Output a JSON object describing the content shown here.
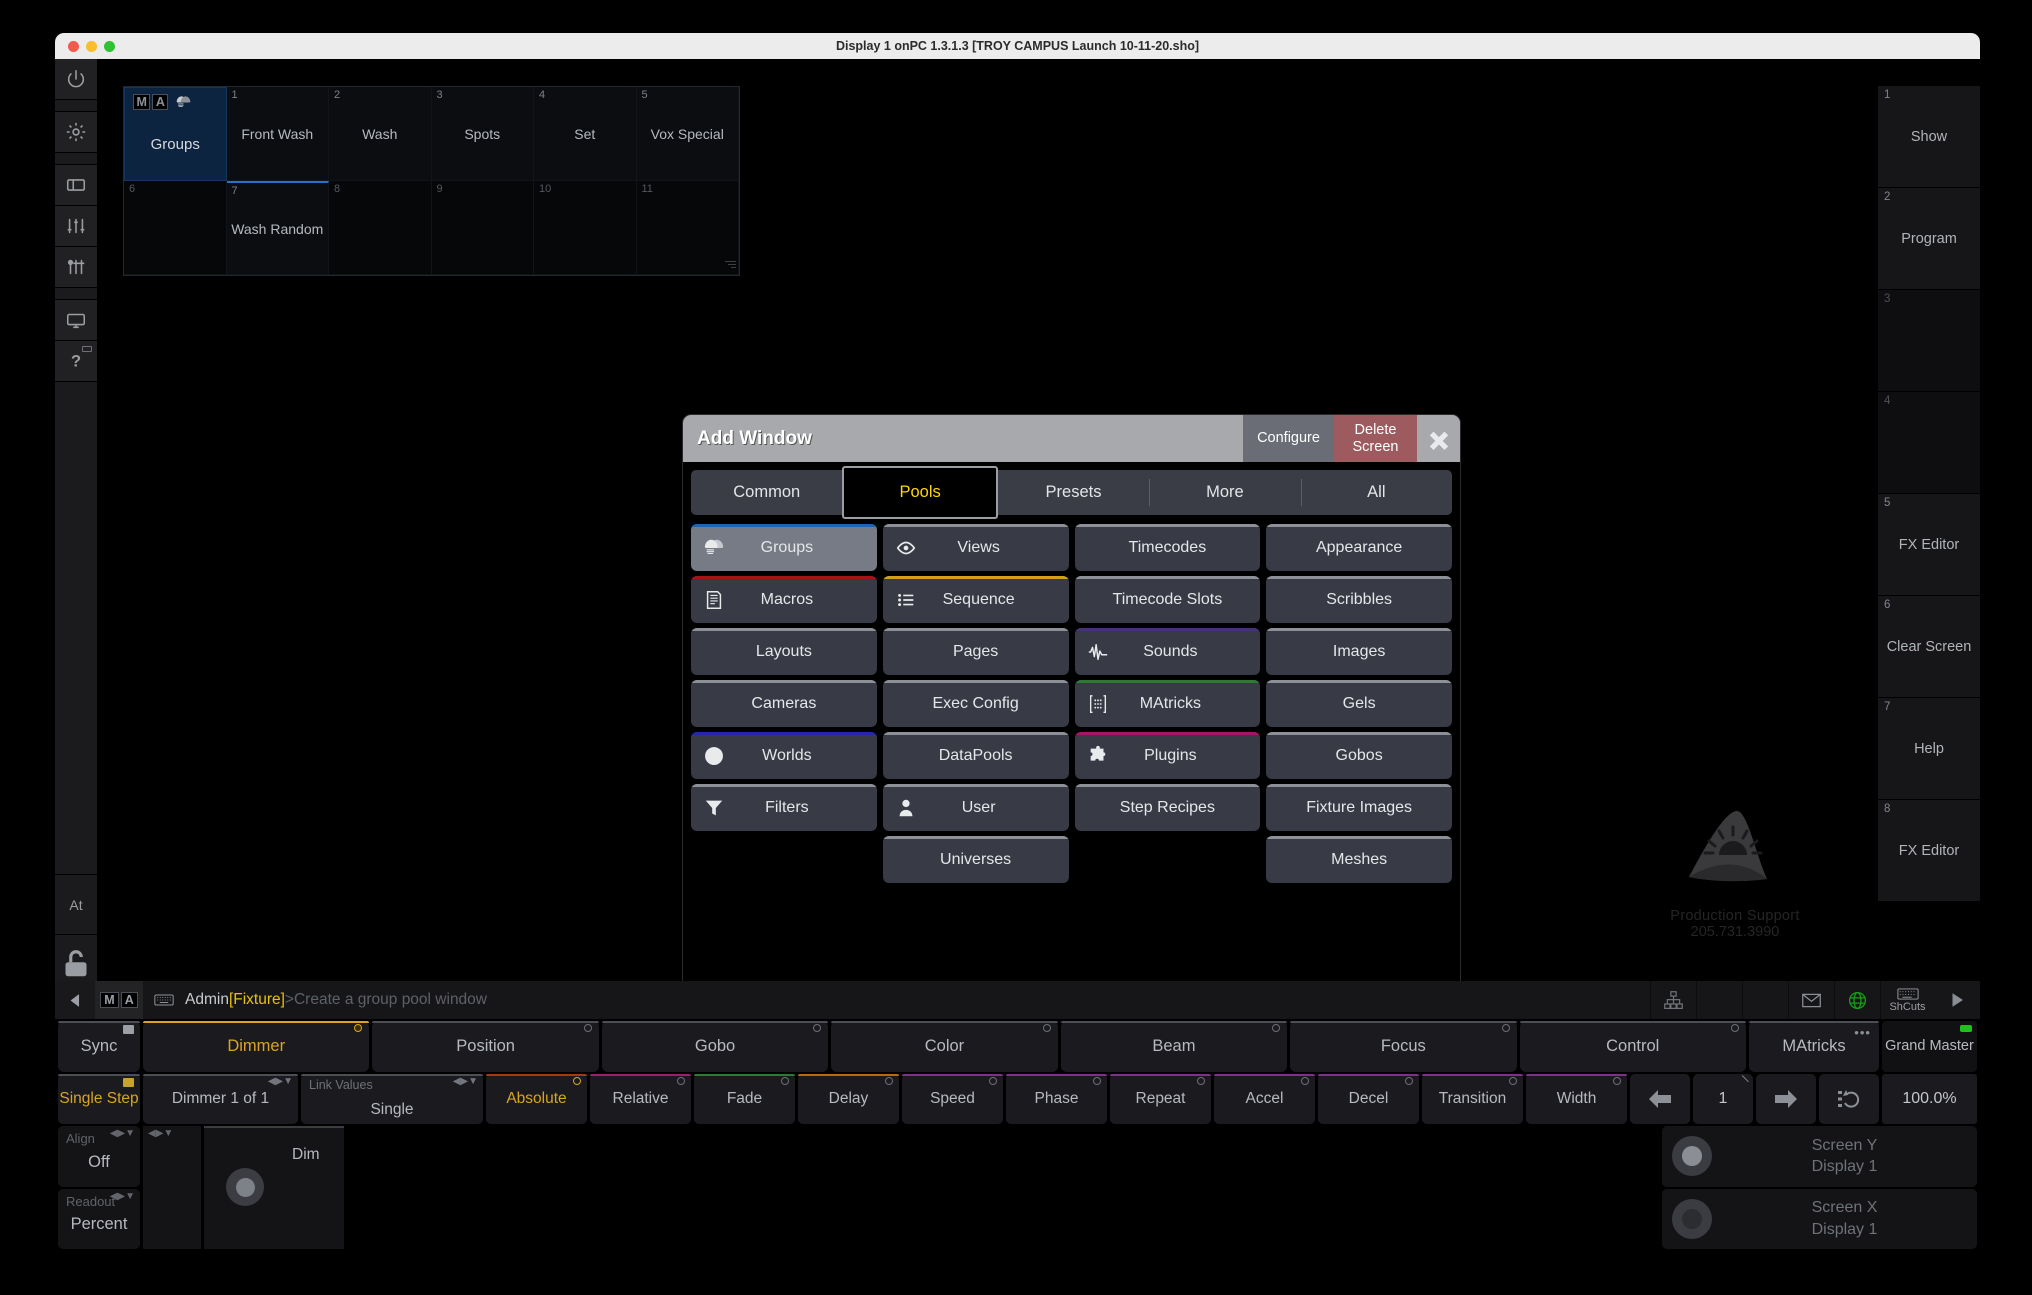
{
  "window": {
    "title": "Display 1 onPC 1.3.1.3 [TROY CAMPUS Launch 10-11-20.sho]"
  },
  "left_rail": {
    "items": [
      {
        "name": "power-icon"
      },
      {
        "name": "gear-icon"
      },
      {
        "name": "window-icon"
      },
      {
        "name": "faders-icon"
      },
      {
        "name": "mixer-icon"
      },
      {
        "name": "display-icon"
      },
      {
        "name": "help-icon"
      }
    ],
    "at_label": "At",
    "lock_label": "lock-icon"
  },
  "groups_pool": {
    "title": "Groups",
    "cells": [
      {
        "index": "",
        "label": "Groups",
        "head": true
      },
      {
        "index": "1",
        "label": "Front Wash"
      },
      {
        "index": "2",
        "label": "Wash"
      },
      {
        "index": "3",
        "label": "Spots"
      },
      {
        "index": "4",
        "label": "Set"
      },
      {
        "index": "5",
        "label": "Vox Special"
      },
      {
        "index": "6",
        "label": "",
        "empty": true
      },
      {
        "index": "7",
        "label": "Wash Random",
        "selected": true
      },
      {
        "index": "8",
        "label": "",
        "empty": true
      },
      {
        "index": "9",
        "label": "",
        "empty": true
      },
      {
        "index": "10",
        "label": "",
        "empty": true
      },
      {
        "index": "11",
        "label": "",
        "empty": true
      }
    ]
  },
  "executors": [
    {
      "num": "1",
      "label": "Show"
    },
    {
      "num": "2",
      "label": "Program"
    },
    {
      "num": "3",
      "label": "",
      "empty": true
    },
    {
      "num": "4",
      "label": "",
      "empty": true
    },
    {
      "num": "5",
      "label": "FX Editor"
    },
    {
      "num": "6",
      "label": "Clear Screen"
    },
    {
      "num": "7",
      "label": "Help"
    },
    {
      "num": "8",
      "label": "FX Editor"
    }
  ],
  "brand": {
    "line1": "Production Support",
    "line2": "205.731.3990"
  },
  "add_window": {
    "title": "Add Window",
    "configure_label": "Configure",
    "delete_label": "Delete Screen",
    "close_label": "close-icon",
    "tabs": [
      {
        "label": "Common",
        "active": false
      },
      {
        "label": "Pools",
        "active": true
      },
      {
        "label": "Presets",
        "active": false
      },
      {
        "label": "More",
        "active": false
      },
      {
        "label": "All",
        "active": false
      }
    ],
    "buttons": [
      {
        "label": "Groups",
        "icon": "groups-icon",
        "bar": "#1f63b5",
        "selected": true
      },
      {
        "label": "Views",
        "icon": "eye-icon",
        "bar": "#8d9096"
      },
      {
        "label": "Timecodes",
        "icon": "",
        "bar": "#8d9096"
      },
      {
        "label": "Appearance",
        "icon": "",
        "bar": "#8d9096"
      },
      {
        "label": "Macros",
        "icon": "macro-icon",
        "bar": "#a81414"
      },
      {
        "label": "Sequence",
        "icon": "list-icon",
        "bar": "#d4a017"
      },
      {
        "label": "Timecode Slots",
        "icon": "",
        "bar": "#8d9096"
      },
      {
        "label": "Scribbles",
        "icon": "",
        "bar": "#8d9096"
      },
      {
        "label": "Layouts",
        "icon": "",
        "bar": "#8d9096"
      },
      {
        "label": "Pages",
        "icon": "",
        "bar": "#8d9096"
      },
      {
        "label": "Sounds",
        "icon": "waveform-icon",
        "bar": "#47307e"
      },
      {
        "label": "Images",
        "icon": "",
        "bar": "#8d9096"
      },
      {
        "label": "Cameras",
        "icon": "",
        "bar": "#8d9096"
      },
      {
        "label": "Exec Config",
        "icon": "",
        "bar": "#8d9096"
      },
      {
        "label": "MAtricks",
        "icon": "matricks-icon",
        "bar": "#2e7a33"
      },
      {
        "label": "Gels",
        "icon": "",
        "bar": "#8d9096"
      },
      {
        "label": "Worlds",
        "icon": "globe-icon",
        "bar": "#2427a8"
      },
      {
        "label": "DataPools",
        "icon": "",
        "bar": "#8d9096"
      },
      {
        "label": "Plugins",
        "icon": "puzzle-icon",
        "bar": "#a0176b"
      },
      {
        "label": "Gobos",
        "icon": "",
        "bar": "#8d9096"
      },
      {
        "label": "Filters",
        "icon": "funnel-icon",
        "bar": "#8d9096"
      },
      {
        "label": "User",
        "icon": "user-icon",
        "bar": "#8d9096"
      },
      {
        "label": "Step Recipes",
        "icon": "",
        "bar": "#8d9096"
      },
      {
        "label": "Fixture Images",
        "icon": "",
        "bar": "#8d9096"
      },
      {
        "label": "",
        "icon": "",
        "blank": true
      },
      {
        "label": "Universes",
        "icon": "",
        "bar": "#8d9096"
      },
      {
        "label": "",
        "icon": "",
        "blank": true
      },
      {
        "label": "Meshes",
        "icon": "",
        "bar": "#8d9096"
      }
    ]
  },
  "command_line": {
    "user": "Admin",
    "bracket": "[Fixture]",
    "arrow": ">",
    "hint": "Create a group pool window",
    "icons": [
      {
        "name": "network-icon"
      },
      {
        "name": "spacer-1"
      },
      {
        "name": "spacer-2"
      },
      {
        "name": "mail-icon"
      },
      {
        "name": "globe-icon"
      }
    ],
    "shcuts_label": "ShCuts",
    "play_label": "play-icon"
  },
  "feature_row": {
    "sync_label": "Sync",
    "features": [
      {
        "label": "Dimmer",
        "selected": true,
        "color": "#d9a520"
      },
      {
        "label": "Position",
        "selected": false,
        "color": "#4b4e55"
      },
      {
        "label": "Gobo",
        "selected": false,
        "color": "#4b4e55"
      },
      {
        "label": "Color",
        "selected": false,
        "color": "#4b4e55"
      },
      {
        "label": "Beam",
        "selected": false,
        "color": "#4b4e55"
      },
      {
        "label": "Focus",
        "selected": false,
        "color": "#4b4e55"
      },
      {
        "label": "Control",
        "selected": false,
        "color": "#4b4e55"
      }
    ],
    "matricks_label": "MAtricks",
    "grand_master_label": "Grand Master"
  },
  "attr_row": {
    "single_step_label": "Single Step",
    "dimmer_count_label": "Dimmer 1 of 1",
    "link_values_label": "Link Values",
    "link_values_value": "Single",
    "attributes": [
      {
        "label": "Absolute",
        "selected": true,
        "color": "#a33a10"
      },
      {
        "label": "Relative",
        "selected": false,
        "color": "#9a1f70"
      },
      {
        "label": "Fade",
        "selected": false,
        "color": "#2e7a33"
      },
      {
        "label": "Delay",
        "selected": false,
        "color": "#b86a12"
      },
      {
        "label": "Speed",
        "selected": false,
        "color": "#7b3287"
      },
      {
        "label": "Phase",
        "selected": false,
        "color": "#7b3287"
      },
      {
        "label": "Repeat",
        "selected": false,
        "color": "#7b3287"
      },
      {
        "label": "Accel",
        "selected": false,
        "color": "#7b3287"
      },
      {
        "label": "Decel",
        "selected": false,
        "color": "#7b3287"
      },
      {
        "label": "Transition",
        "selected": false,
        "color": "#7b3287"
      },
      {
        "label": "Width",
        "selected": false,
        "color": "#7b3287"
      }
    ],
    "page_value": "1",
    "grand_master_value": "100.0%"
  },
  "encoder_row": {
    "align_label": "Align",
    "align_value": "Off",
    "readout_label": "Readout",
    "readout_value": "Percent",
    "dim_label": "Dim",
    "screen_encoders": [
      {
        "title": "Screen Y",
        "sub": "Display 1",
        "lit": true
      },
      {
        "title": "Screen X",
        "sub": "Display 1",
        "lit": false
      }
    ]
  }
}
